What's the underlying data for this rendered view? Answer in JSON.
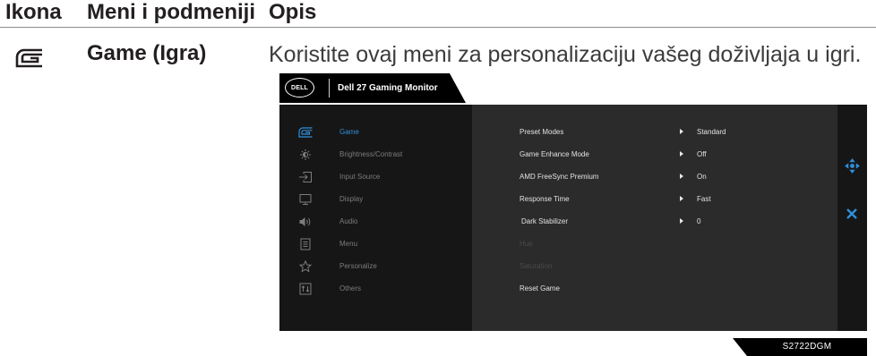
{
  "table": {
    "headers": {
      "icon": "Ikona",
      "menu": "Meni i podmeniji",
      "description": "Opis"
    },
    "row": {
      "icon": "game-icon",
      "menu": "Game (Igra)",
      "description": "Koristite ovaj meni za personalizaciju vašeg doživljaja u igri."
    }
  },
  "osd": {
    "logo_text": "DELL",
    "title": "Dell 27 Gaming Monitor",
    "menu": [
      {
        "label": "Game",
        "icon": "game-icon",
        "selected": true
      },
      {
        "label": "Brightness/Contrast",
        "icon": "brightness-icon",
        "selected": false
      },
      {
        "label": "Input Source",
        "icon": "input-source-icon",
        "selected": false
      },
      {
        "label": "Display",
        "icon": "display-icon",
        "selected": false
      },
      {
        "label": "Audio",
        "icon": "speaker-icon",
        "selected": false
      },
      {
        "label": "Menu",
        "icon": "menu-icon",
        "selected": false
      },
      {
        "label": "Personalize",
        "icon": "star-icon",
        "selected": false
      },
      {
        "label": "Others",
        "icon": "others-icon",
        "selected": false
      }
    ],
    "submenu": [
      {
        "label": "Preset Modes",
        "value": "Standard",
        "enabled": true,
        "has_arrow": true
      },
      {
        "label": "Game Enhance Mode",
        "value": "Off",
        "enabled": true,
        "has_arrow": true
      },
      {
        "label": "AMD FreeSync Premium",
        "value": "On",
        "enabled": true,
        "has_arrow": true
      },
      {
        "label": "Response Time",
        "value": "Fast",
        "enabled": true,
        "has_arrow": true
      },
      {
        "label": "Dark Stabilizer",
        "value": "0",
        "enabled": true,
        "has_arrow": true
      },
      {
        "label": "Hue",
        "enabled": false,
        "has_arrow": false
      },
      {
        "label": "Saturation",
        "enabled": false,
        "has_arrow": false
      },
      {
        "label": "Reset Game",
        "enabled": true,
        "has_arrow": false
      }
    ],
    "side_controls": {
      "navigate_icon": "joystick-icon",
      "close_icon": "close-icon"
    },
    "model": "S2722DGM"
  },
  "colors": {
    "accent": "#2f8fdb",
    "osd_text": "#e2e2e2",
    "osd_muted": "#7c7c7c",
    "osd_disabled": "#4a4a4a",
    "text": "#231f20"
  }
}
